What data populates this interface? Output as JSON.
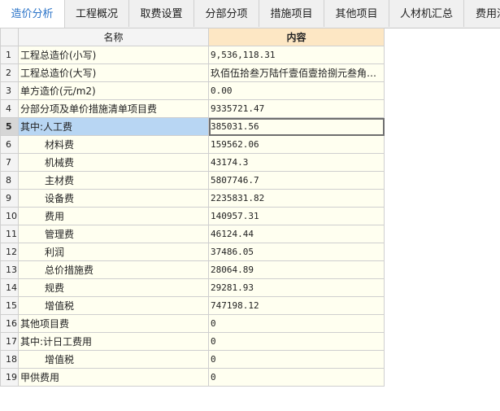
{
  "tabs": [
    {
      "label": "造价分析",
      "active": true
    },
    {
      "label": "工程概况"
    },
    {
      "label": "取费设置"
    },
    {
      "label": "分部分项"
    },
    {
      "label": "措施项目"
    },
    {
      "label": "其他项目"
    },
    {
      "label": "人材机汇总"
    },
    {
      "label": "费用汇"
    }
  ],
  "table": {
    "headers": {
      "name": "名称",
      "content": "内容"
    },
    "rows": [
      {
        "num": "1",
        "name": "工程总造价(小写)",
        "value": "9,536,118.31"
      },
      {
        "num": "2",
        "name": "工程总造价(大写)",
        "value": "玖佰伍拾叁万陆仟壹佰壹拾捌元叁角壹分"
      },
      {
        "num": "3",
        "name": "单方造价(元/m2)",
        "value": "0.00"
      },
      {
        "num": "4",
        "name": "分部分项及单价措施清单项目费",
        "value": "9335721.47"
      },
      {
        "num": "5",
        "name": "其中:人工费",
        "value": "385031.56"
      },
      {
        "num": "6",
        "name": "材料费",
        "value": "159562.06"
      },
      {
        "num": "7",
        "name": "机械费",
        "value": "43174.3"
      },
      {
        "num": "8",
        "name": "主材费",
        "value": "5807746.7"
      },
      {
        "num": "9",
        "name": "设备费",
        "value": "2235831.82"
      },
      {
        "num": "10",
        "name": "费用",
        "value": "140957.31"
      },
      {
        "num": "11",
        "name": "管理费",
        "value": "46124.44"
      },
      {
        "num": "12",
        "name": "利润",
        "value": "37486.05"
      },
      {
        "num": "13",
        "name": "总价措施费",
        "value": "28064.89"
      },
      {
        "num": "14",
        "name": "规费",
        "value": "29281.93"
      },
      {
        "num": "15",
        "name": "增值税",
        "value": "747198.12"
      },
      {
        "num": "16",
        "name": "其他项目费",
        "value": "0"
      },
      {
        "num": "17",
        "name": "其中:计日工费用",
        "value": "0"
      },
      {
        "num": "18",
        "name": "增值税",
        "value": "0"
      },
      {
        "num": "19",
        "name": "甲供费用",
        "value": "0"
      }
    ]
  }
}
